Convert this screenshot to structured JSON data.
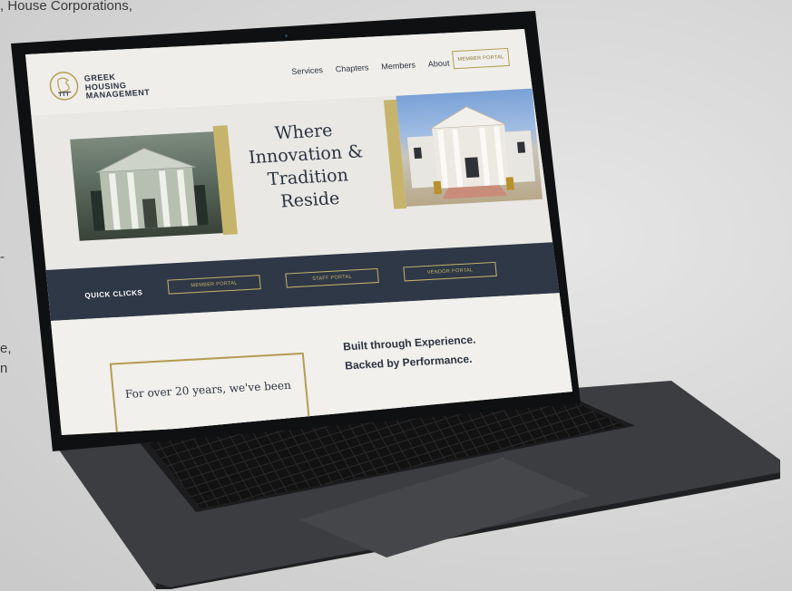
{
  "background_copy": {
    "line1": ", House Corporations,",
    "line2": "-",
    "line3": "e,",
    "line4": "n"
  },
  "site": {
    "logo": {
      "line1": "GREEK",
      "line2": "HOUSING",
      "line3": "MANAGEMENT"
    },
    "nav": [
      "Services",
      "Chapters",
      "Members",
      "About"
    ],
    "header_cta": "MEMBER PORTAL",
    "hero_title": [
      "Where",
      "Innovation &",
      "Tradition",
      "Reside"
    ],
    "quick_clicks": {
      "title": "QUICK CLICKS",
      "buttons": [
        "MEMBER PORTAL",
        "STAFF PORTAL",
        "VENDOR PORTAL"
      ]
    },
    "intro_text": "For over 20 years, we've been",
    "tagline": [
      "Built through Experience.",
      "Backed by Performance."
    ]
  },
  "colors": {
    "navy": "#2e3846",
    "gold": "#c7b46c",
    "page_bg": "#e9e8e4",
    "laptop": "#3c3d40"
  }
}
